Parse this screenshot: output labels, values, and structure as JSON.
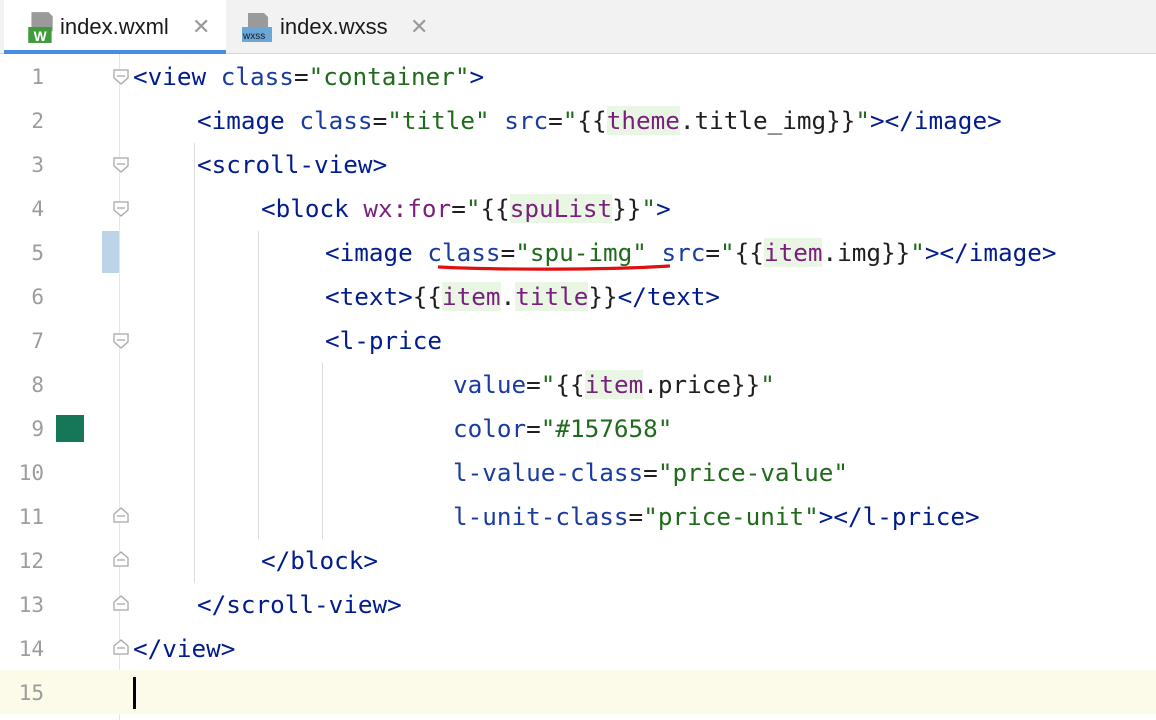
{
  "tabs": [
    {
      "label": "index.wxml",
      "icon": "wxml-file-icon",
      "icon_text": "W",
      "active": true
    },
    {
      "label": "index.wxss",
      "icon": "wxss-file-icon",
      "icon_text": "wxss",
      "active": false
    }
  ],
  "tab_close_glyph": "✕",
  "line_numbers": [
    "1",
    "2",
    "3",
    "4",
    "5",
    "6",
    "7",
    "8",
    "9",
    "10",
    "11",
    "12",
    "13",
    "14",
    "15"
  ],
  "color_swatch": "#157658",
  "code": {
    "l1": {
      "lt": "<",
      "tag": "view",
      "sp": " ",
      "a1": "class",
      "eq": "=",
      "v1": "\"container\"",
      "gt": ">"
    },
    "l2": {
      "lt": "<",
      "tag": "image",
      "a1": "class",
      "v1": "\"title\"",
      "a2": "src",
      "q1": "\"",
      "o": "{{",
      "e1": "theme",
      "dot": ".",
      "e2": "title_img",
      "c": "}}",
      "q2": "\"",
      "gt": ">",
      "close": "</image>"
    },
    "l3": {
      "lt": "<",
      "tag": "scroll-view",
      "gt": ">"
    },
    "l4": {
      "lt": "<",
      "tag": "block",
      "ns": "wx:for",
      "eq": "=",
      "q1": "\"",
      "o": "{{",
      "e1": "spuList",
      "c": "}}",
      "q2": "\"",
      "gt": ">"
    },
    "l5": {
      "lt": "<",
      "tag": "image",
      "a1": "class",
      "v1": "\"spu-img\"",
      "a2": "src",
      "q1": "\"",
      "o": "{{",
      "e1": "item",
      "dot": ".",
      "e2": "img",
      "c": "}}",
      "q2": "\"",
      "gt": ">",
      "close": "</image>"
    },
    "l6": {
      "open": "<text>",
      "o": "{{",
      "e1": "item",
      "dot": ".",
      "e2": "title",
      "c": "}}",
      "close": "</text>"
    },
    "l7": {
      "lt": "<",
      "tag": "l-price"
    },
    "l8": {
      "a1": "value",
      "eq": "=",
      "q1": "\"",
      "o": "{{",
      "e1": "item",
      "dot": ".",
      "e2": "price",
      "c": "}}",
      "q2": "\""
    },
    "l9": {
      "a1": "color",
      "eq": "=",
      "v1": "\"#157658\""
    },
    "l10": {
      "a1": "l-value-class",
      "eq": "=",
      "v1": "\"price-value\""
    },
    "l11": {
      "a1": "l-unit-class",
      "eq": "=",
      "v1": "\"price-unit\"",
      "gt": ">",
      "close": "</l-price>"
    },
    "l12": {
      "close": "</block>"
    },
    "l13": {
      "close": "</scroll-view>"
    },
    "l14": {
      "close": "</view>"
    }
  },
  "annotation": {
    "underline_color": "#e01010"
  }
}
